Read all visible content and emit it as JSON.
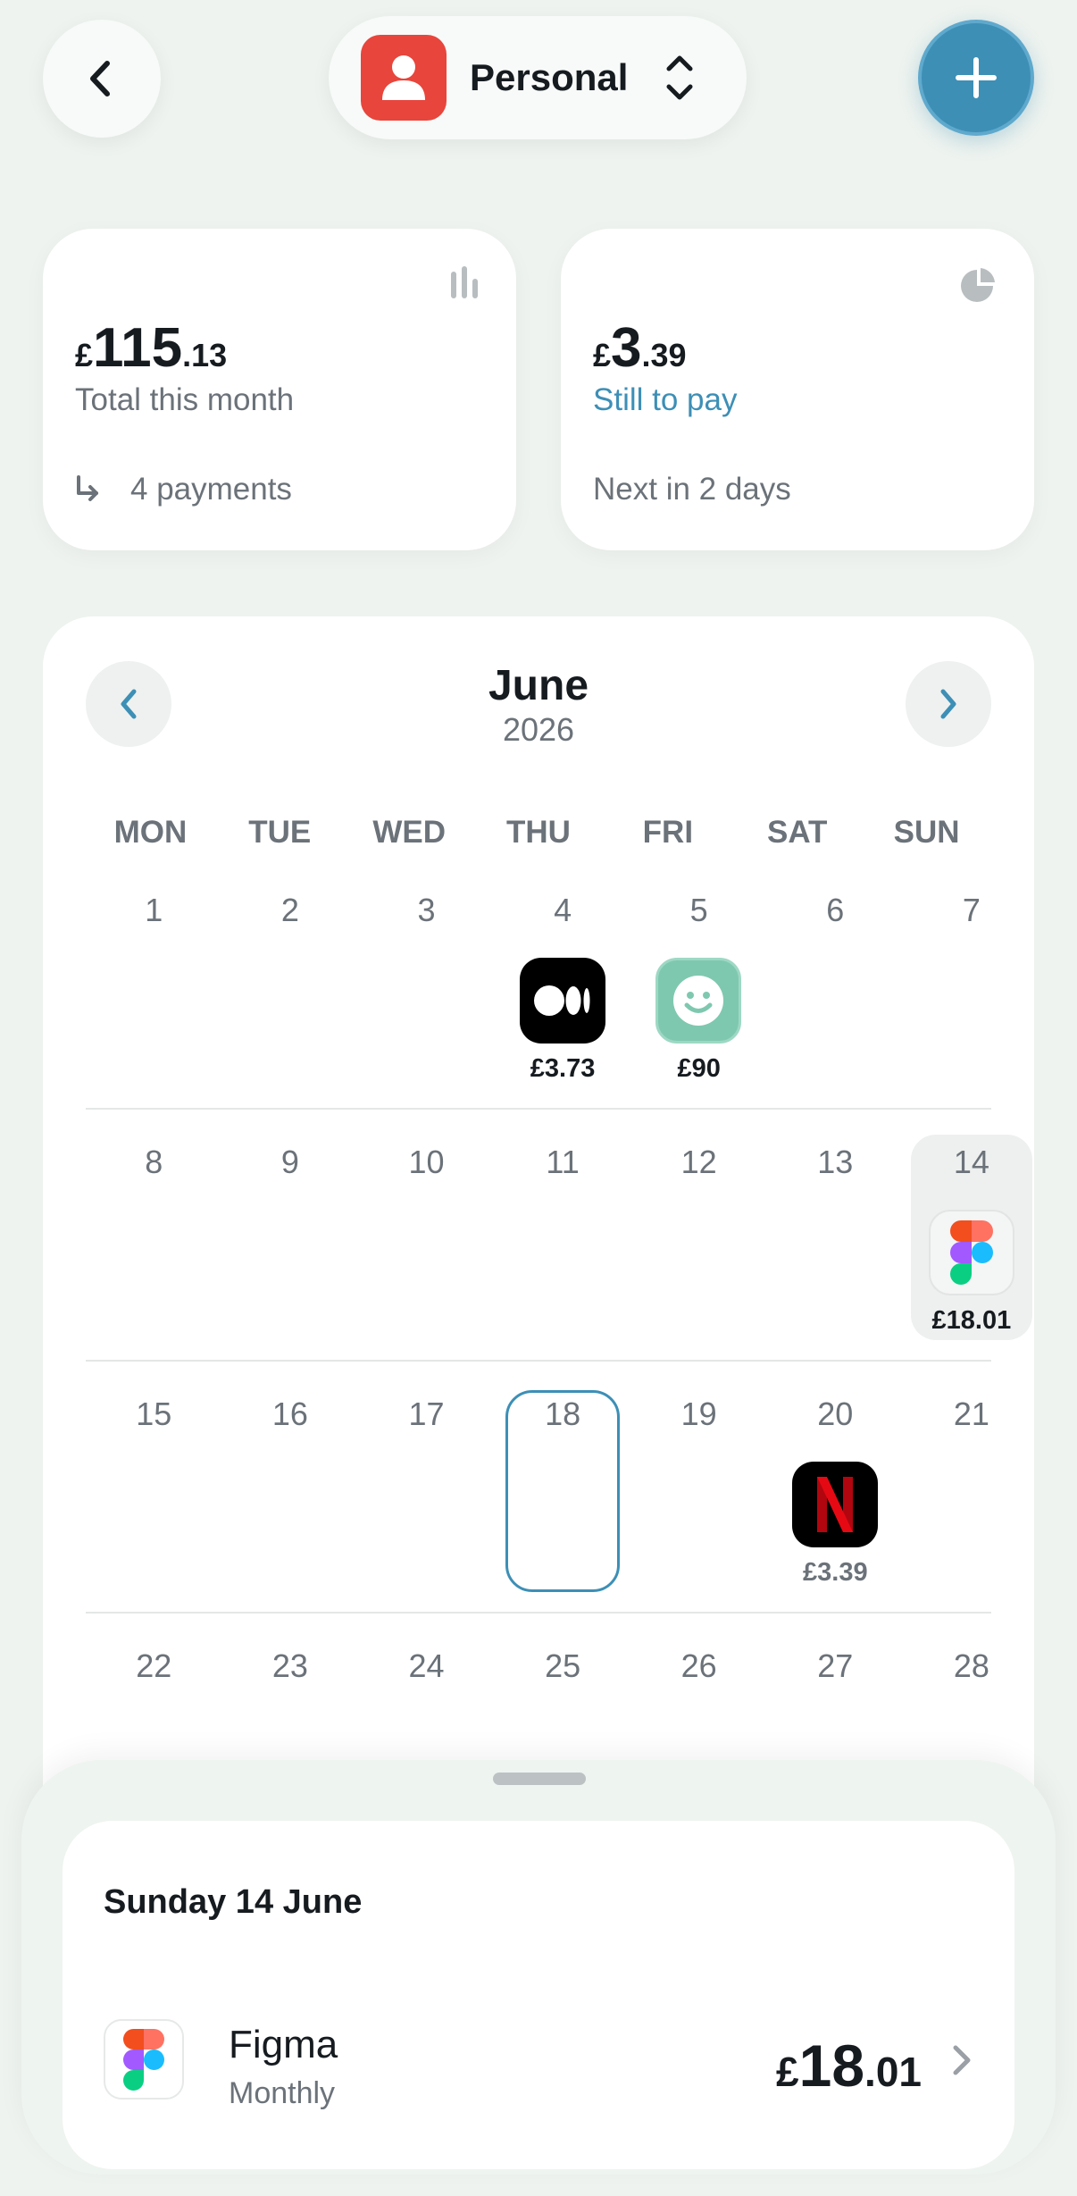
{
  "header": {
    "profile_name": "Personal"
  },
  "summary": {
    "total": {
      "currency": "£",
      "amount_major": "115",
      "amount_minor": ".13",
      "label": "Total this month",
      "footer": "4 payments"
    },
    "remaining": {
      "currency": "£",
      "amount_major": "3",
      "amount_minor": ".39",
      "label": "Still to pay",
      "footer": "Next in 2 days"
    }
  },
  "calendar": {
    "month": "June",
    "year": "2026",
    "weekdays": [
      "MON",
      "TUE",
      "WED",
      "THU",
      "FRI",
      "SAT",
      "SUN"
    ],
    "weeks": [
      [
        "1",
        "2",
        "3",
        "4",
        "5",
        "6",
        "7"
      ],
      [
        "8",
        "9",
        "10",
        "11",
        "12",
        "13",
        "14"
      ],
      [
        "15",
        "16",
        "17",
        "18",
        "19",
        "20",
        "21"
      ],
      [
        "22",
        "23",
        "24",
        "25",
        "26",
        "27",
        "28"
      ]
    ],
    "payments": {
      "medium": "£3.73",
      "smile": "£90",
      "figma": "£18.01",
      "netflix": "£3.39"
    }
  },
  "sheet": {
    "date": "Sunday 14 June",
    "subscription": {
      "name": "Figma",
      "frequency": "Monthly",
      "currency": "£",
      "amount_major": "18",
      "amount_minor": ".01"
    }
  },
  "colors": {
    "accent": "#3d8fb6",
    "profile": "#e8453c",
    "background": "#eef3ef",
    "smile_app": "#7fc8b0",
    "netflix_red": "#e50914"
  }
}
